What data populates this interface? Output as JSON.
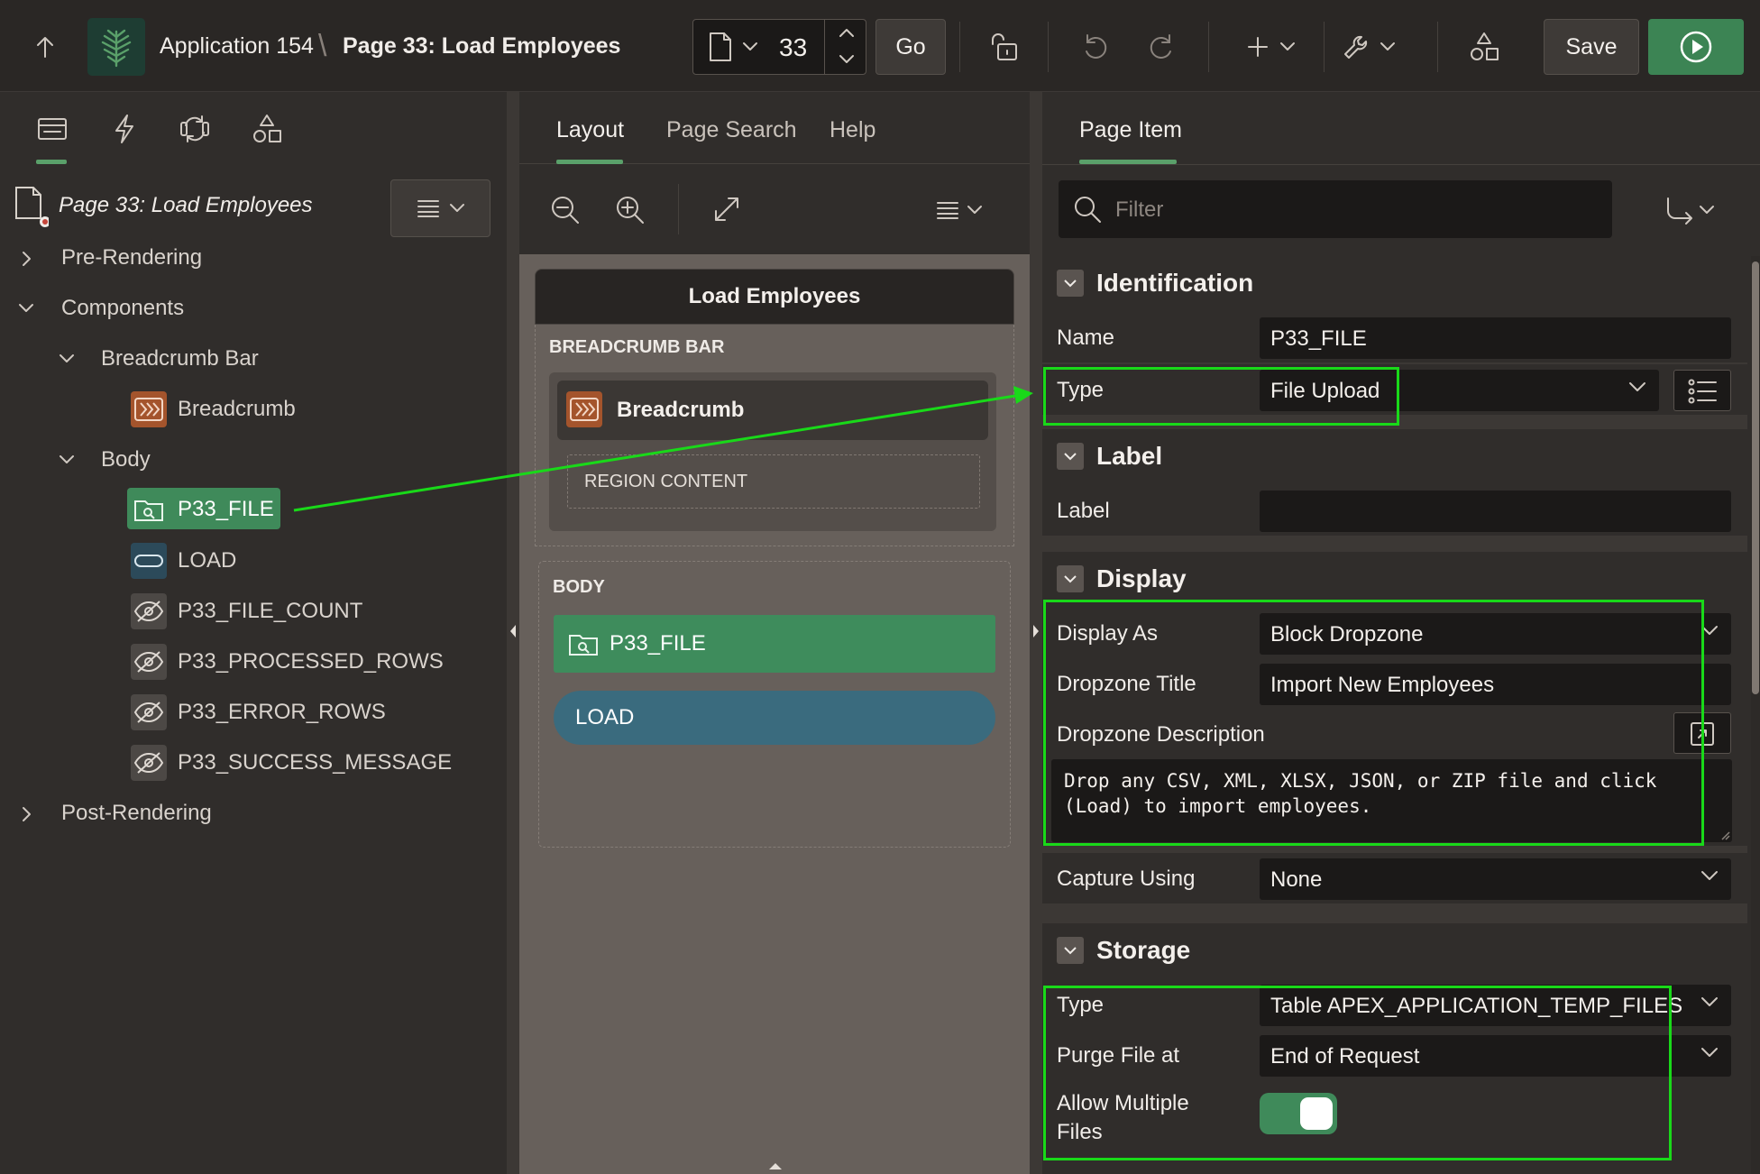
{
  "header": {
    "app_name": "Application 154",
    "separator": "\\",
    "page_title": "Page 33: Load Employees",
    "page_number": "33",
    "go_label": "Go",
    "save_label": "Save"
  },
  "left_panel": {
    "root_label": "Page 33: Load Employees",
    "tree": {
      "pre_rendering": "Pre-Rendering",
      "components": "Components",
      "breadcrumb_bar": "Breadcrumb Bar",
      "breadcrumb": "Breadcrumb",
      "body": "Body",
      "items": [
        "P33_FILE",
        "LOAD",
        "P33_FILE_COUNT",
        "P33_PROCESSED_ROWS",
        "P33_ERROR_ROWS",
        "P33_SUCCESS_MESSAGE"
      ],
      "post_rendering": "Post-Rendering"
    }
  },
  "middle_panel": {
    "tabs": [
      "Layout",
      "Page Search",
      "Help"
    ],
    "region_title": "Load Employees",
    "breadcrumb_bar_title": "BREADCRUMB BAR",
    "breadcrumb_label": "Breadcrumb",
    "region_content": "REGION CONTENT",
    "body_title": "BODY",
    "file_item": "P33_FILE",
    "load_button": "LOAD"
  },
  "right_panel": {
    "tab": "Page Item",
    "filter_placeholder": "Filter",
    "identification": {
      "title": "Identification",
      "name_label": "Name",
      "name_value": "P33_FILE",
      "type_label": "Type",
      "type_value": "File Upload"
    },
    "label_section": {
      "title": "Label",
      "label_label": "Label",
      "label_value": ""
    },
    "display": {
      "title": "Display",
      "display_as_label": "Display As",
      "display_as_value": "Block Dropzone",
      "dropzone_title_label": "Dropzone Title",
      "dropzone_title_value": "Import New Employees",
      "dropzone_desc_label": "Dropzone Description",
      "dropzone_desc_line1": "Drop any CSV, XML, XLSX, JSON, or ZIP file and click",
      "dropzone_desc_line2": "(Load) to import employees.",
      "capture_label": "Capture Using",
      "capture_value": "None"
    },
    "storage": {
      "title": "Storage",
      "type_label": "Type",
      "type_value": "Table APEX_APPLICATION_TEMP_FILES",
      "purge_label": "Purge File at",
      "purge_value": "End of Request",
      "multiple_label_line1": "Allow Multiple",
      "multiple_label_line2": "Files",
      "multiple_value": "on"
    }
  },
  "colors": {
    "accent_green": "#3f8a5a",
    "highlight": "#19d919",
    "breadcrumb_orange": "#a4542c",
    "button_teal": "#3a6b7e"
  }
}
